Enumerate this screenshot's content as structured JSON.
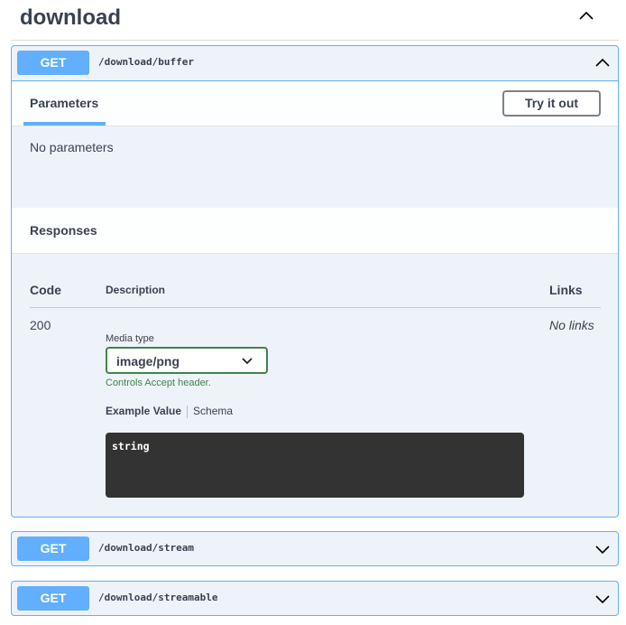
{
  "section": {
    "title": "download"
  },
  "operations": [
    {
      "method": "GET",
      "path": "/download/buffer",
      "expanded": true,
      "tab_label": "Parameters",
      "try_button": "Try it out",
      "no_parameters": "No parameters",
      "responses_title": "Responses",
      "columns": {
        "code": "Code",
        "description": "Description",
        "links": "Links"
      },
      "response": {
        "code": "200",
        "links": "No links",
        "media_type_label": "Media type",
        "media_type_value": "image/png",
        "media_hint": "Controls Accept header.",
        "example_tab": "Example Value",
        "schema_tab": "Schema",
        "example_code": "string"
      }
    },
    {
      "method": "GET",
      "path": "/download/stream",
      "expanded": false
    },
    {
      "method": "GET",
      "path": "/download/streamable",
      "expanded": false
    }
  ],
  "icons": {
    "collapse": "chevron-up-icon",
    "expand": "chevron-down-icon"
  },
  "colors": {
    "get_method": "#61affe",
    "block_background": "#eef3f9",
    "select_border": "#41844a",
    "code_background": "#333333"
  }
}
